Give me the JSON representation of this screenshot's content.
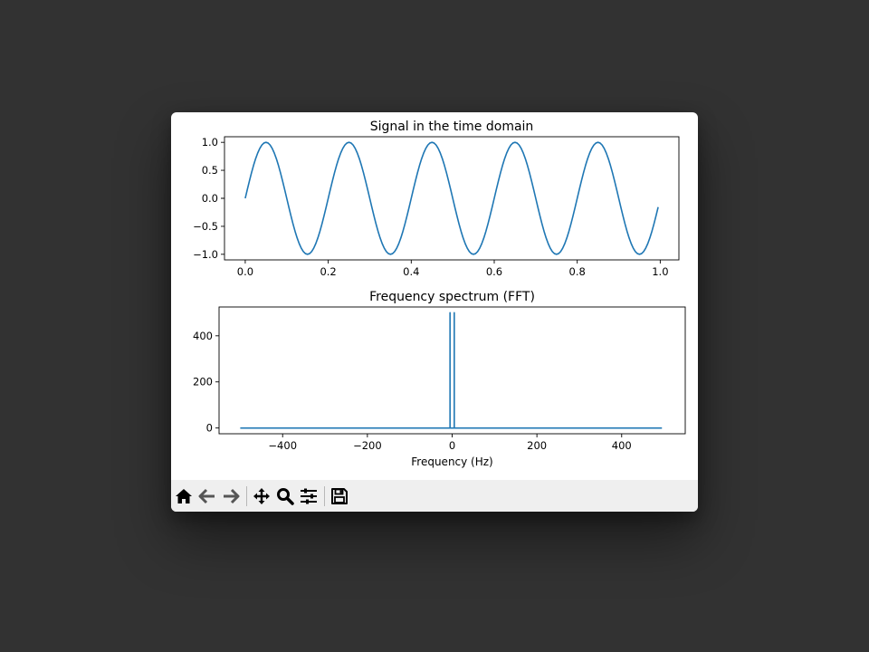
{
  "chart_data": [
    {
      "type": "line",
      "title": "Signal in the time domain",
      "xlabel": "",
      "ylabel": "",
      "xlim": [
        -0.05,
        1.045
      ],
      "ylim": [
        -1.1,
        1.1
      ],
      "xticks": [
        0.0,
        0.2,
        0.4,
        0.6,
        0.8,
        1.0
      ],
      "xtick_labels": [
        "0.0",
        "0.2",
        "0.4",
        "0.6",
        "0.8",
        "1.0"
      ],
      "yticks": [
        1.0,
        0.5,
        0.0,
        -0.5,
        -1.0
      ],
      "ytick_labels": [
        "1.0",
        "0.5",
        "0.0",
        "−0.5",
        "−1.0"
      ],
      "series": [
        {
          "function": "sin(2*pi*5*t)",
          "x_start": 0.0,
          "x_end": 0.995,
          "samples": 200,
          "color": "#1f77b4"
        }
      ]
    },
    {
      "type": "line",
      "title": "Frequency spectrum (FFT)",
      "xlabel": "Frequency (Hz)",
      "ylabel": "",
      "xlim": [
        -550,
        550
      ],
      "ylim": [
        -25,
        525
      ],
      "xticks": [
        -400,
        -200,
        0,
        200,
        400
      ],
      "xtick_labels": [
        "−400",
        "−200",
        "0",
        "200",
        "400"
      ],
      "yticks": [
        0,
        200,
        400
      ],
      "ytick_labels": [
        "0",
        "200",
        "400"
      ],
      "series": [
        {
          "x": [
            -500,
            -5,
            -5,
            -5,
            5,
            5,
            5,
            495
          ],
          "y": [
            0,
            0,
            500,
            0,
            0,
            500,
            0,
            0
          ],
          "color": "#1f77b4"
        }
      ]
    }
  ],
  "toolbar": {
    "buttons": [
      {
        "icon": "home-icon"
      },
      {
        "icon": "back-arrow-icon"
      },
      {
        "icon": "forward-arrow-icon"
      },
      {
        "icon": "pan-icon"
      },
      {
        "icon": "zoom-icon"
      },
      {
        "icon": "configure-subplots-icon"
      },
      {
        "icon": "save-icon"
      }
    ]
  },
  "colors": {
    "line": "#1f77b4",
    "background": "#323232",
    "toolbar": "#efefef"
  }
}
